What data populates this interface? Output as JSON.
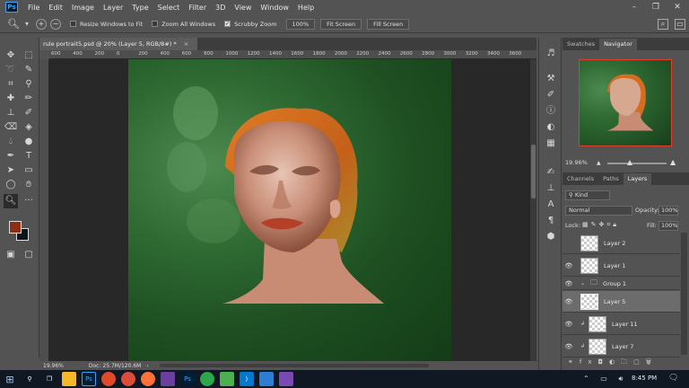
{
  "app": {
    "logo": "Ps"
  },
  "menu": [
    "File",
    "Edit",
    "Image",
    "Layer",
    "Type",
    "Select",
    "Filter",
    "3D",
    "View",
    "Window",
    "Help"
  ],
  "options": {
    "resize_windows": "Resize Windows to Fit",
    "zoom_all": "Zoom All Windows",
    "scrubby_zoom": "Scrubby Zoom",
    "zoom_value": "100%",
    "fit_screen": "Fit Screen",
    "fill_screen": "Fill Screen"
  },
  "document": {
    "tab_title": "rule portrait5.psd @ 20% (Layer 5, RGB/8#) *",
    "close": "×"
  },
  "ruler": [
    "600",
    "400",
    "200",
    "0",
    "200",
    "400",
    "600",
    "800",
    "1000",
    "1200",
    "1400",
    "1600",
    "1800",
    "2000",
    "2200",
    "2400",
    "2600",
    "2800",
    "3000",
    "3200",
    "3400",
    "3600"
  ],
  "status": {
    "zoom": "19.96%",
    "doc_info": "Doc: 25.7M/120.6M"
  },
  "panels": {
    "top_tabs": [
      "Swatches",
      "Navigator"
    ],
    "nav_zoom": "19.96%",
    "layer_tabs": [
      "Channels",
      "Paths",
      "Layers"
    ],
    "filter_kind": "Kind",
    "blend_mode": "Normal",
    "opacity_label": "Opacity:",
    "opacity_value": "100%",
    "lock_label": "Lock:",
    "fill_label": "Fill:",
    "fill_value": "100%",
    "layers": [
      {
        "name": "Layer 2",
        "visible": false
      },
      {
        "name": "Layer 1",
        "visible": true
      },
      {
        "name": "Group 1",
        "visible": true
      },
      {
        "name": "Layer 5",
        "visible": true
      },
      {
        "name": "Layer 11",
        "visible": true
      },
      {
        "name": "Layer 7",
        "visible": true
      }
    ]
  },
  "taskbar": {
    "time": "8:45 PM"
  },
  "colors": {
    "foreground": "#8a2f16",
    "background": "#0d1518",
    "accent": "#31a8ff",
    "nav_frame": "#e0402a"
  }
}
